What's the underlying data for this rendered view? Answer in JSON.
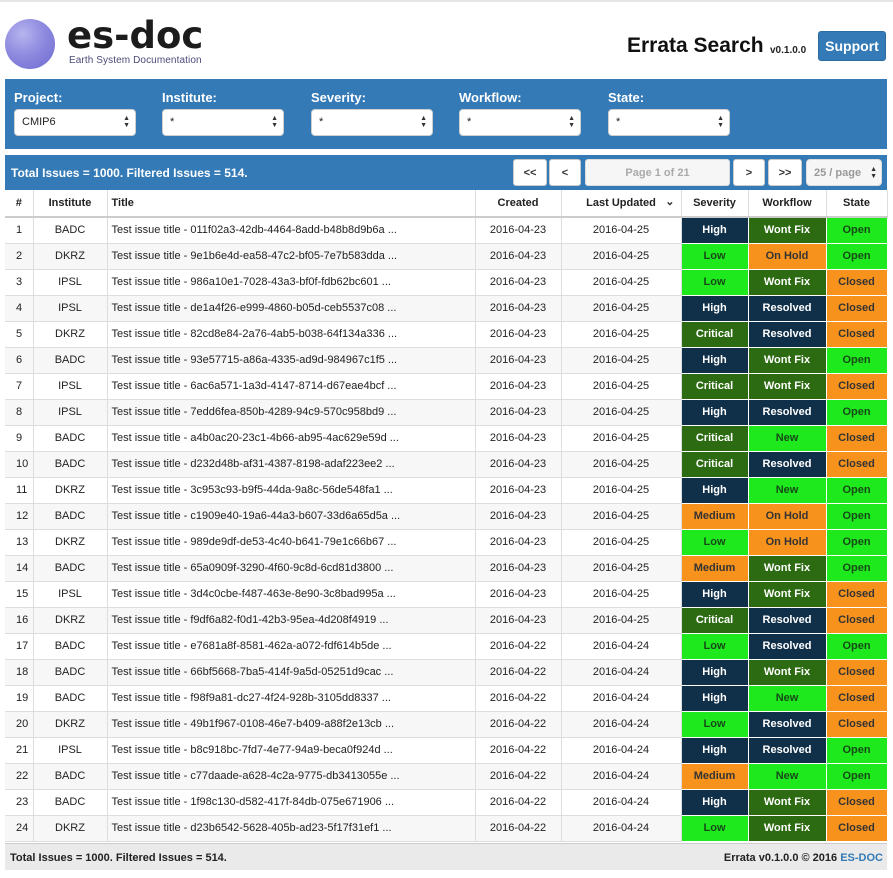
{
  "header": {
    "logo_text": "es-doc",
    "logo_subtitle": "Earth System Documentation",
    "app_title": "Errata Search",
    "version": "v0.1.0.0",
    "support_label": "Support"
  },
  "filters": [
    {
      "label": "Project:",
      "value": "CMIP6"
    },
    {
      "label": "Institute:",
      "value": "*"
    },
    {
      "label": "Severity:",
      "value": "*"
    },
    {
      "label": "Workflow:",
      "value": "*"
    },
    {
      "label": "State:",
      "value": "*"
    }
  ],
  "pager": {
    "totals": "Total Issues = 1000. Filtered Issues = 514.",
    "first": "<<",
    "prev": "<",
    "page": "Page 1 of 21",
    "next": ">",
    "last": ">>",
    "page_size": "25 / page"
  },
  "table": {
    "headers": [
      "#",
      "Institute",
      "Title",
      "Created",
      "Last Updated",
      "Severity",
      "Workflow",
      "State"
    ],
    "rows": [
      [
        "1",
        "BADC",
        "Test issue title - 011f02a3-42db-4464-8add-b48b8d9b6a ...",
        "2016-04-23",
        "2016-04-25",
        "High",
        "Wont Fix",
        "Open"
      ],
      [
        "2",
        "DKRZ",
        "Test issue title - 9e1b6e4d-ea58-47c2-bf05-7e7b583dda ...",
        "2016-04-23",
        "2016-04-25",
        "Low",
        "On Hold",
        "Open"
      ],
      [
        "3",
        "IPSL",
        "Test issue title - 986a10e1-7028-43a3-bf0f-fdb62bc601 ...",
        "2016-04-23",
        "2016-04-25",
        "Low",
        "Wont Fix",
        "Closed"
      ],
      [
        "4",
        "IPSL",
        "Test issue title - de1a4f26-e999-4860-b05d-ceb5537c08 ...",
        "2016-04-23",
        "2016-04-25",
        "High",
        "Resolved",
        "Closed"
      ],
      [
        "5",
        "DKRZ",
        "Test issue title - 82cd8e84-2a76-4ab5-b038-64f134a336 ...",
        "2016-04-23",
        "2016-04-25",
        "Critical",
        "Resolved",
        "Closed"
      ],
      [
        "6",
        "BADC",
        "Test issue title - 93e57715-a86a-4335-ad9d-984967c1f5 ...",
        "2016-04-23",
        "2016-04-25",
        "High",
        "Wont Fix",
        "Open"
      ],
      [
        "7",
        "IPSL",
        "Test issue title - 6ac6a571-1a3d-4147-8714-d67eae4bcf ...",
        "2016-04-23",
        "2016-04-25",
        "Critical",
        "Wont Fix",
        "Closed"
      ],
      [
        "8",
        "IPSL",
        "Test issue title - 7edd6fea-850b-4289-94c9-570c958bd9 ...",
        "2016-04-23",
        "2016-04-25",
        "High",
        "Resolved",
        "Open"
      ],
      [
        "9",
        "BADC",
        "Test issue title - a4b0ac20-23c1-4b66-ab95-4ac629e59d ...",
        "2016-04-23",
        "2016-04-25",
        "Critical",
        "New",
        "Closed"
      ],
      [
        "10",
        "BADC",
        "Test issue title - d232d48b-af31-4387-8198-adaf223ee2 ...",
        "2016-04-23",
        "2016-04-25",
        "Critical",
        "Resolved",
        "Closed"
      ],
      [
        "11",
        "DKRZ",
        "Test issue title - 3c953c93-b9f5-44da-9a8c-56de548fa1 ...",
        "2016-04-23",
        "2016-04-25",
        "High",
        "New",
        "Open"
      ],
      [
        "12",
        "BADC",
        "Test issue title - c1909e40-19a6-44a3-b607-33d6a65d5a ...",
        "2016-04-23",
        "2016-04-25",
        "Medium",
        "On Hold",
        "Open"
      ],
      [
        "13",
        "DKRZ",
        "Test issue title - 989de9df-de53-4c40-b641-79e1c66b67 ...",
        "2016-04-23",
        "2016-04-25",
        "Low",
        "On Hold",
        "Open"
      ],
      [
        "14",
        "BADC",
        "Test issue title - 65a0909f-3290-4f60-9c8d-6cd81d3800 ...",
        "2016-04-23",
        "2016-04-25",
        "Medium",
        "Wont Fix",
        "Open"
      ],
      [
        "15",
        "IPSL",
        "Test issue title - 3d4c0cbe-f487-463e-8e90-3c8bad995a ...",
        "2016-04-23",
        "2016-04-25",
        "High",
        "Wont Fix",
        "Closed"
      ],
      [
        "16",
        "DKRZ",
        "Test issue title - f9df6a82-f0d1-42b3-95ea-4d208f4919 ...",
        "2016-04-23",
        "2016-04-25",
        "Critical",
        "Resolved",
        "Closed"
      ],
      [
        "17",
        "BADC",
        "Test issue title - e7681a8f-8581-462a-a072-fdf614b5de ...",
        "2016-04-22",
        "2016-04-24",
        "Low",
        "Resolved",
        "Open"
      ],
      [
        "18",
        "BADC",
        "Test issue title - 66bf5668-7ba5-414f-9a5d-05251d9cac ...",
        "2016-04-22",
        "2016-04-24",
        "High",
        "Wont Fix",
        "Closed"
      ],
      [
        "19",
        "BADC",
        "Test issue title - f98f9a81-dc27-4f24-928b-3105dd8337 ...",
        "2016-04-22",
        "2016-04-24",
        "High",
        "New",
        "Closed"
      ],
      [
        "20",
        "DKRZ",
        "Test issue title - 49b1f967-0108-46e7-b409-a88f2e13cb ...",
        "2016-04-22",
        "2016-04-24",
        "Low",
        "Resolved",
        "Closed"
      ],
      [
        "21",
        "IPSL",
        "Test issue title - b8c918bc-7fd7-4e77-94a9-beca0f924d ...",
        "2016-04-22",
        "2016-04-24",
        "High",
        "Resolved",
        "Open"
      ],
      [
        "22",
        "BADC",
        "Test issue title - c77daade-a628-4c2a-9775-db3413055e ...",
        "2016-04-22",
        "2016-04-24",
        "Medium",
        "New",
        "Open"
      ],
      [
        "23",
        "BADC",
        "Test issue title - 1f98c130-d582-417f-84db-075e671906 ...",
        "2016-04-22",
        "2016-04-24",
        "High",
        "Wont Fix",
        "Closed"
      ],
      [
        "24",
        "DKRZ",
        "Test issue title - d23b6542-5628-405b-ad23-5f17f31ef1 ...",
        "2016-04-22",
        "2016-04-24",
        "Low",
        "Wont Fix",
        "Closed"
      ]
    ]
  },
  "footer": {
    "left": "Total Issues = 1000. Filtered Issues = 514.",
    "right_prefix": "Errata v0.1.0.0 © 2016 ",
    "right_link": "ES-DOC"
  },
  "colors": {
    "primary": "#337ab7",
    "high": "#10304a",
    "low": "#1de91d",
    "critical": "#2d6b13",
    "medium": "#f7931d"
  },
  "icons": {
    "sort_chevron": "chevron-down-icon",
    "select_arrows": "select-arrows-icon"
  }
}
